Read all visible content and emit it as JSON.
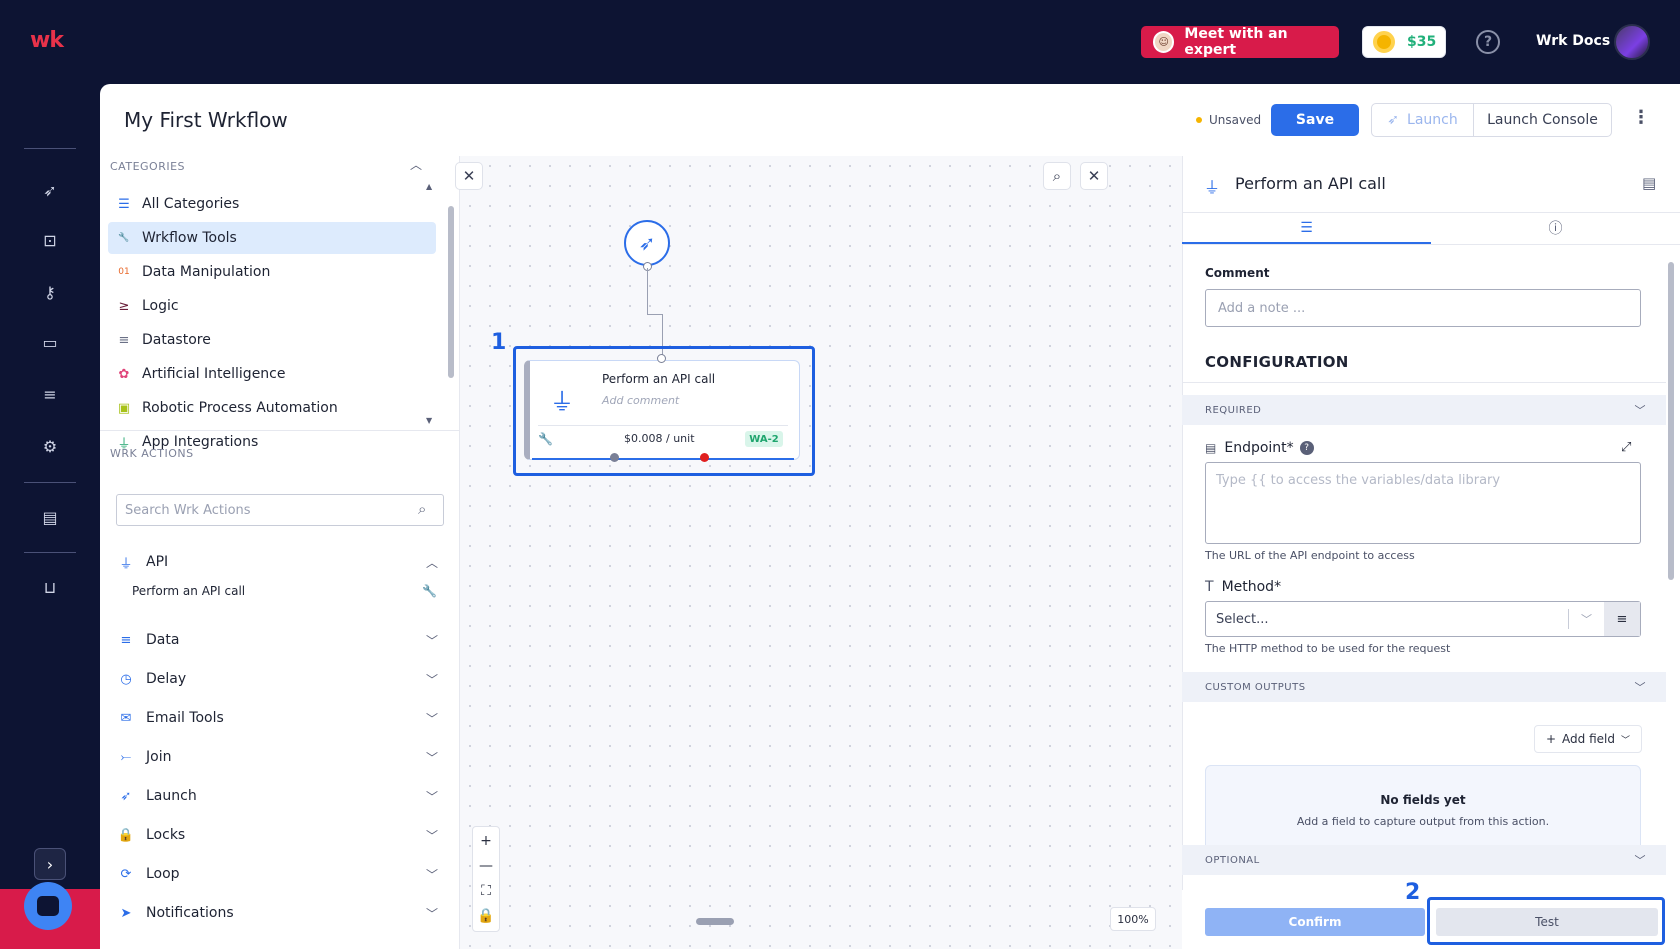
{
  "header": {
    "logo": "wk",
    "expert_button": "Meet with an expert",
    "credit": "$35",
    "help": "?",
    "user_name": "Wrk Docs"
  },
  "workflow": {
    "title": "My First Wrkflow",
    "status": "Unsaved",
    "save": "Save",
    "launch": "Launch",
    "launch_console": "Launch Console",
    "more": "⋮"
  },
  "sidebar": {
    "categories_header": "CATEGORIES",
    "categories": [
      {
        "label": "All Categories",
        "icon": "list-icon",
        "glyph": "☰",
        "color": "#2b6de8"
      },
      {
        "label": "Wrkflow Tools",
        "icon": "wrench-icon",
        "glyph": "🔧",
        "color": "#6a8fe0"
      },
      {
        "label": "Data Manipulation",
        "icon": "binary-icon",
        "glyph": "01",
        "color": "#e8682a"
      },
      {
        "label": "Logic",
        "icon": "greater-equal-icon",
        "glyph": "≥",
        "color": "#6a1f3a"
      },
      {
        "label": "Datastore",
        "icon": "database-icon",
        "glyph": "≡",
        "color": "#6a7086"
      },
      {
        "label": "Artificial Intelligence",
        "icon": "brain-icon",
        "glyph": "✿",
        "color": "#e0457a"
      },
      {
        "label": "Robotic Process Automation",
        "icon": "robot-icon",
        "glyph": "▣",
        "color": "#a8c21a"
      },
      {
        "label": "App Integrations",
        "icon": "plug-icon",
        "glyph": "⏚",
        "color": "#1fa56e"
      }
    ],
    "actions_header": "WRK ACTIONS",
    "search_placeholder": "Search Wrk Actions",
    "action_groups": [
      {
        "label": "API",
        "icon": "plug-icon",
        "glyph": "⏚",
        "expanded": true
      },
      {
        "label": "Data",
        "icon": "database-icon",
        "glyph": "≡"
      },
      {
        "label": "Delay",
        "icon": "clock-icon",
        "glyph": "◷"
      },
      {
        "label": "Email Tools",
        "icon": "envelope-icon",
        "glyph": "✉"
      },
      {
        "label": "Join",
        "icon": "join-icon",
        "glyph": "⤚"
      },
      {
        "label": "Launch",
        "icon": "rocket-icon",
        "glyph": "➶"
      },
      {
        "label": "Locks",
        "icon": "lock-icon",
        "glyph": "🔒"
      },
      {
        "label": "Loop",
        "icon": "loop-icon",
        "glyph": "⟳"
      },
      {
        "label": "Notifications",
        "icon": "send-icon",
        "glyph": "➤"
      }
    ],
    "api_sub_item": "Perform an API call"
  },
  "canvas": {
    "annotation_1": "1",
    "node": {
      "title": "Perform an API call",
      "comment_placeholder": "Add comment",
      "price": "$0.008 / unit",
      "badge": "WA-2"
    },
    "zoom_level": "100%"
  },
  "config_panel": {
    "title": "Perform an API call",
    "comment_label": "Comment",
    "comment_placeholder": "Add a note ...",
    "configuration": "CONFIGURATION",
    "required": "REQUIRED",
    "endpoint_label": "Endpoint*",
    "endpoint_placeholder": "Type {{ to access the variables/data library",
    "endpoint_help": "The URL of the API endpoint to access",
    "method_label": "Method*",
    "method_value": "Select...",
    "method_help": "The HTTP method to be used for the request",
    "custom_outputs": "CUSTOM OUTPUTS",
    "add_field": "Add field",
    "no_fields_title": "No fields yet",
    "no_fields_desc": "Add a field to capture output from this action.",
    "optional": "OPTIONAL",
    "confirm": "Confirm",
    "test": "Test",
    "annotation_2": "2"
  },
  "colors": {
    "accent": "#2b6de8",
    "nav_bg": "#0d1433",
    "expert_red": "#d81b4a",
    "highlight": "#1e5fe0"
  }
}
